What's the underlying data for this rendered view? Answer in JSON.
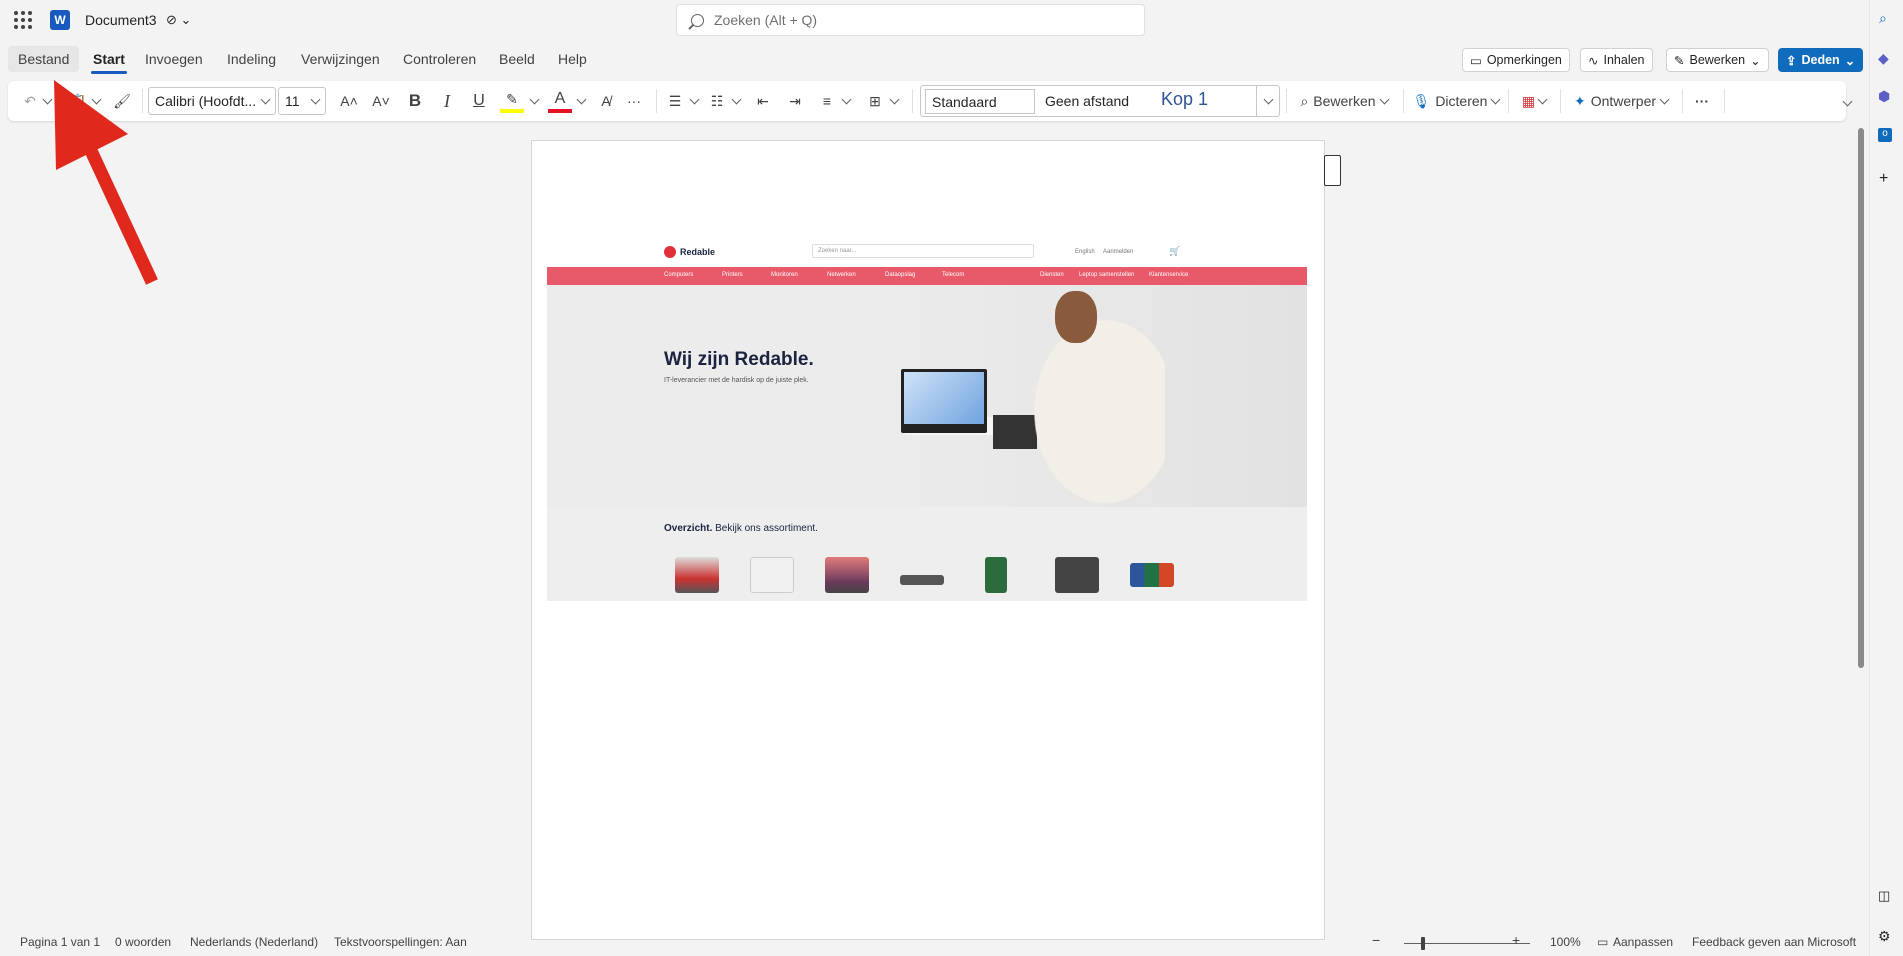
{
  "app": {
    "title": "Document3",
    "search_placeholder": "Zoeken (Alt + Q)"
  },
  "menu": {
    "tabs": [
      "Bestand",
      "Start",
      "Invoegen",
      "Indeling",
      "Verwijzingen",
      "Controleren",
      "Beeld",
      "Help"
    ],
    "selected": "Start"
  },
  "actions": {
    "comments": "Opmerkingen",
    "catchup": "Inhalen",
    "edit": "Bewerken",
    "share": "Deden"
  },
  "ribbon": {
    "font": "Calibri (Hoofdt...",
    "size": "11",
    "bold": "B",
    "italic": "I",
    "underline": "U",
    "styles": [
      "Standaard",
      "Geen afstand",
      "Kop 1"
    ],
    "find": "Bewerken",
    "dictate": "Dicteren",
    "designer": "Ontwerper",
    "more": "···"
  },
  "image": {
    "brand": "Redable",
    "search": "Zoeken naar...",
    "nav": [
      "Computers",
      "Printers",
      "Monitoren",
      "Netwerken",
      "Dataopslag",
      "Telecom",
      "Diensten",
      "Leptop samenstellen",
      "Klantenservice"
    ],
    "headline": "Wij zijn Redable.",
    "subline": "IT-leverancier met de hardisk op de juiste plek.",
    "overview_bold": "Overzicht.",
    "overview": "Bekijk ons assortiment.",
    "lang": "English",
    "account": "Aanmelden"
  },
  "status": {
    "page": "Pagina 1 van 1",
    "words": "0 woorden",
    "language": "Nederlands (Nederland)",
    "predictions": "Tekstvoorspellingen: Aan",
    "zoom": "100%",
    "fit": "Aanpassen",
    "feedback": "Feedback geven aan Microsoft"
  },
  "colors": {
    "accent": "#185abd",
    "share": "#0f6cbd",
    "arrow": "#e0281c",
    "nav": "#e85a6a"
  }
}
